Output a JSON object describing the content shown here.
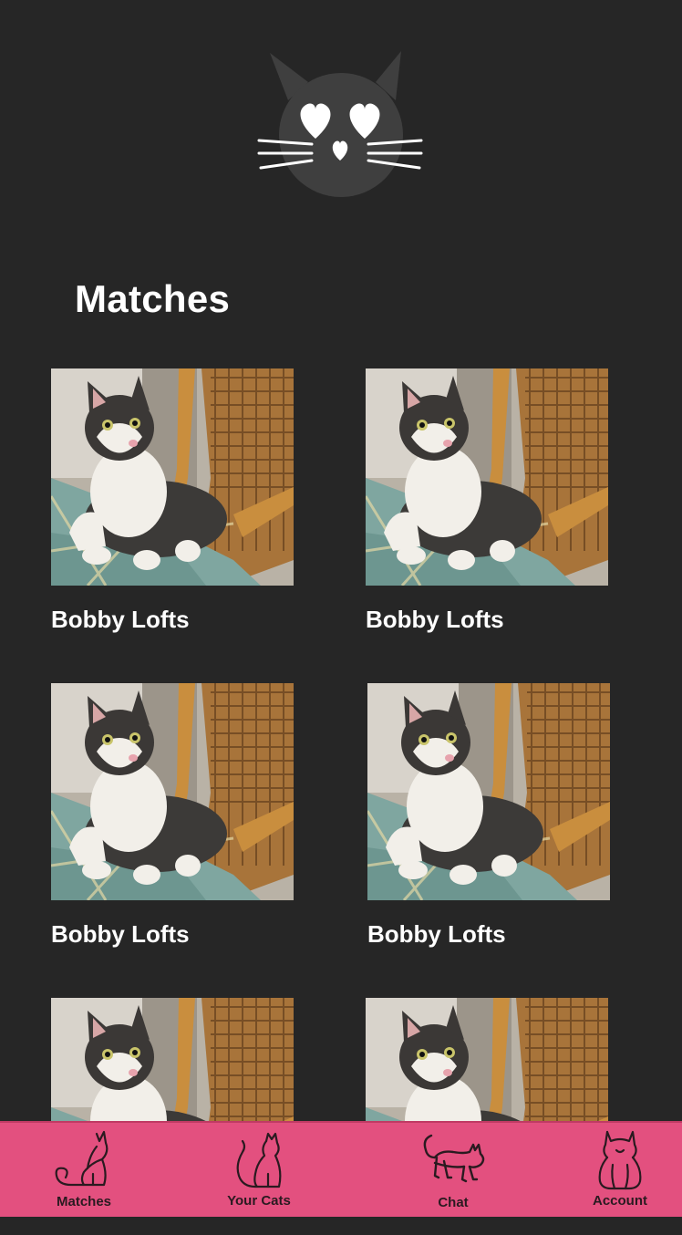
{
  "header": {
    "logo_icon": "cat-heart-eyes-icon"
  },
  "page": {
    "title": "Matches"
  },
  "matches": [
    {
      "name": "Bobby Lofts"
    },
    {
      "name": "Bobby Lofts"
    },
    {
      "name": "Bobby Lofts"
    },
    {
      "name": "Bobby Lofts"
    },
    {
      "name": ""
    },
    {
      "name": ""
    }
  ],
  "tabbar": {
    "background_color": "#e3507f",
    "tabs": [
      {
        "label": "Matches",
        "icon": "sitting-cat-icon"
      },
      {
        "label": "Your Cats",
        "icon": "cat-profile-icon"
      },
      {
        "label": "Chat",
        "icon": "walking-cat-icon"
      },
      {
        "label": "Account",
        "icon": "cat-front-icon"
      }
    ]
  }
}
